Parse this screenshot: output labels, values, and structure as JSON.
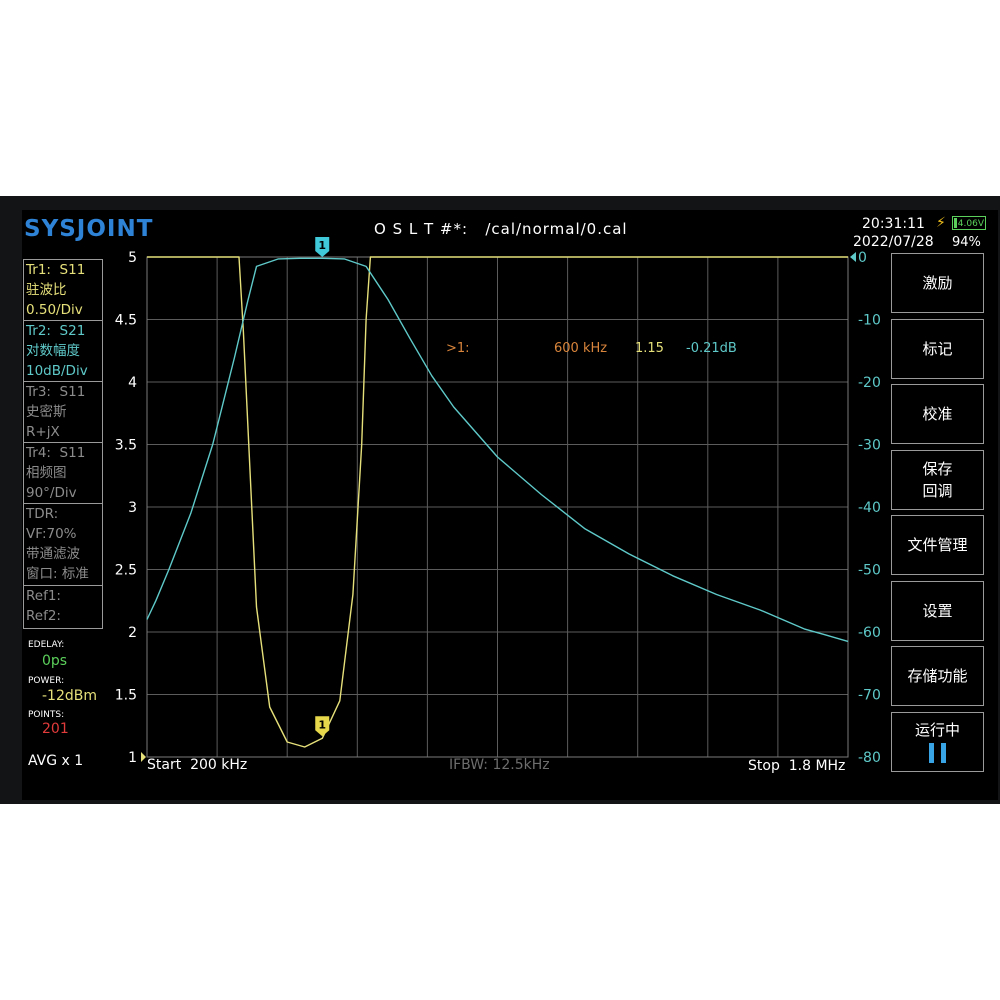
{
  "header": {
    "logo": "SYSJOINT",
    "cal_path": "O S L T #*:   /cal/normal/0.cal",
    "time": "20:31:11",
    "date": "2022/07/28",
    "battery_voltage": "4.06V",
    "battery_percent": "94%"
  },
  "traces": {
    "tr1_id": "Tr1:",
    "tr1_param": "S11",
    "tr1_format": "驻波比",
    "tr1_scale": "0.50/Div",
    "tr2_id": "Tr2:",
    "tr2_param": "S21",
    "tr2_format": "对数幅度",
    "tr2_scale": "10dB/Div",
    "tr3_id": "Tr3:",
    "tr3_param": "S11",
    "tr3_format": "史密斯",
    "tr3_scale": "R+jX",
    "tr4_id": "Tr4:",
    "tr4_param": "S11",
    "tr4_format": "相频图",
    "tr4_scale": "90°/Div",
    "tdr_label": "TDR:",
    "tdr_vf": "VF:70%",
    "tdr_mode": "带通滤波",
    "tdr_window": "窗口: 标准",
    "ref1": "Ref1:",
    "ref2": "Ref2:"
  },
  "info": {
    "edelay_label": "EDELAY:",
    "edelay_value": "0ps",
    "power_label": "POWER:",
    "power_value": "-12dBm",
    "points_label": "POINTS:",
    "points_value": "201",
    "avg": "AVG x 1"
  },
  "plot": {
    "left_ticks": [
      "5",
      "4.5",
      "4",
      "3.5",
      "3",
      "2.5",
      "2",
      "1.5",
      "1"
    ],
    "right_ticks": [
      "0",
      "-10",
      "-20",
      "-30",
      "-40",
      "-50",
      "-60",
      "-70",
      "-80"
    ],
    "start_label": "Start  200 kHz",
    "stop_label": "Stop  1.8 MHz",
    "ifbw_label": "IFBW: 12.5kHz",
    "marker_id": ">1:",
    "marker_freq": "600 kHz",
    "marker_swr": "1.15",
    "marker_db": "-0.21dB",
    "marker_number": "1"
  },
  "colors": {
    "tr1": "#e6e07a",
    "tr2": "#5fc9c9",
    "grid": "#5c5c5c",
    "marker_text": "#d9853b",
    "points_value": "#e23b3b",
    "logo": "#2f83d6"
  },
  "chart_data": {
    "type": "line",
    "x_start_khz": 200,
    "x_stop_khz": 1800,
    "x_marker_khz": 600,
    "series": [
      {
        "name": "Tr1",
        "axis": "left",
        "x_khz": [
          200,
          400,
          410,
          420,
          450,
          480,
          520,
          560,
          600,
          640,
          670,
          690,
          700,
          710,
          720,
          730,
          1800
        ],
        "y": [
          5,
          5,
          5,
          4.4,
          2.2,
          1.4,
          1.12,
          1.08,
          1.15,
          1.45,
          2.3,
          3.5,
          4.5,
          5,
          5,
          5,
          5
        ]
      },
      {
        "name": "Tr2",
        "axis": "right",
        "x_khz": [
          200,
          220,
          250,
          300,
          350,
          400,
          430,
          450,
          500,
          550,
          600,
          650,
          700,
          750,
          800,
          850,
          900,
          1000,
          1100,
          1200,
          1300,
          1400,
          1500,
          1600,
          1700,
          1750,
          1800
        ],
        "y": [
          -58,
          -55,
          -50,
          -41,
          -30,
          -16,
          -7,
          -1.5,
          -0.3,
          -0.2,
          -0.21,
          -0.3,
          -1.5,
          -6.8,
          -13,
          -19,
          -24,
          -32,
          -38,
          -43.5,
          -47.5,
          -51,
          -54,
          -56.5,
          -59.5,
          -60.5,
          -61.5
        ]
      }
    ],
    "ylim_left": [
      1,
      5
    ],
    "ylim_right": [
      -80,
      0
    ],
    "grid": true
  },
  "buttons": {
    "stimulus": "激励",
    "marker": "标记",
    "calibrate": "校准",
    "save_line1": "保存",
    "save_line2": "回调",
    "file_manager": "文件管理",
    "settings": "设置",
    "storage": "存储功能",
    "running": "运行中",
    "pause_icon": "pause-icon"
  }
}
